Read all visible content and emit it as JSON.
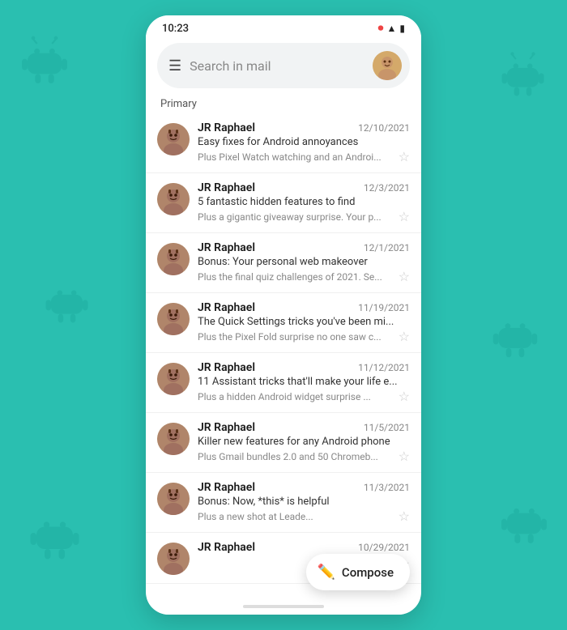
{
  "status_bar": {
    "time": "10:23",
    "icons": [
      "record",
      "wifi",
      "battery"
    ]
  },
  "search": {
    "placeholder": "Search in mail"
  },
  "section": {
    "label": "Primary"
  },
  "emails": [
    {
      "sender": "JR Raphael",
      "date": "12/10/2021",
      "subject": "Easy fixes for Android annoyances",
      "preview": "Plus Pixel Watch watching and an Androi...",
      "starred": false
    },
    {
      "sender": "JR Raphael",
      "date": "12/3/2021",
      "subject": "5 fantastic hidden features to find",
      "preview": "Plus a gigantic giveaway surprise. Your p...",
      "starred": false
    },
    {
      "sender": "JR Raphael",
      "date": "12/1/2021",
      "subject": "Bonus: Your personal web makeover",
      "preview": "Plus the final quiz challenges of 2021. Se...",
      "starred": false
    },
    {
      "sender": "JR Raphael",
      "date": "11/19/2021",
      "subject": "The Quick Settings tricks you've been mi...",
      "preview": "Plus the Pixel Fold surprise no one saw c...",
      "starred": false
    },
    {
      "sender": "JR Raphael",
      "date": "11/12/2021",
      "subject": "11 Assistant tricks that'll make your life e...",
      "preview": "Plus a hidden Android widget surprise   ...",
      "starred": false
    },
    {
      "sender": "JR Raphael",
      "date": "11/5/2021",
      "subject": "Killer new features for any Android phone",
      "preview": "Plus Gmail bundles 2.0 and 50 Chromeb...",
      "starred": false
    },
    {
      "sender": "JR Raphael",
      "date": "11/3/2021",
      "subject": "Bonus: Now, *this* is helpful",
      "preview": "Plus a new shot at Leade...",
      "starred": false
    },
    {
      "sender": "JR Raphael",
      "date": "10/29/2021",
      "subject": "",
      "preview": "",
      "starred": false
    }
  ],
  "compose": {
    "label": "Compose"
  }
}
